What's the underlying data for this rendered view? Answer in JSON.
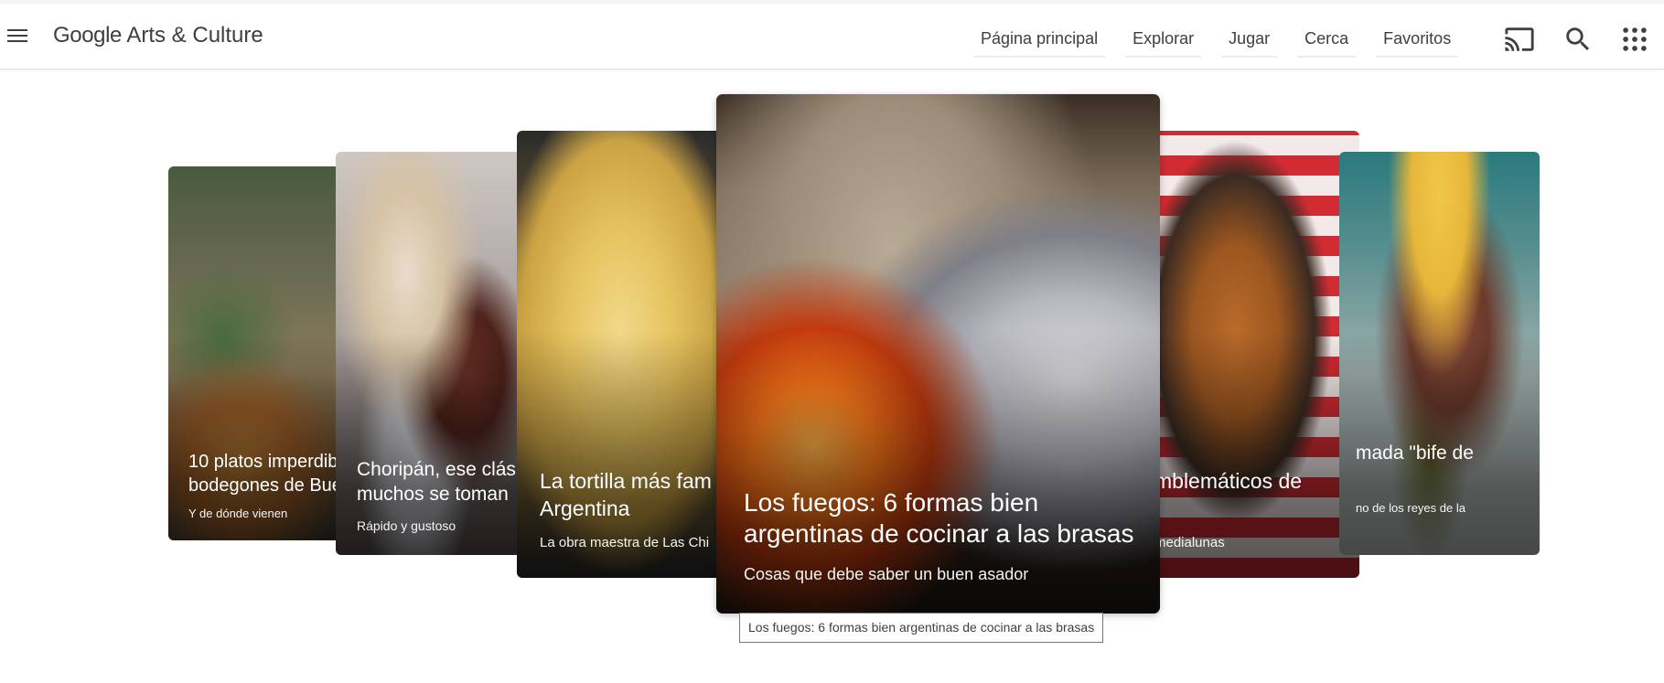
{
  "app": {
    "brand_google": "Google",
    "brand_rest": " Arts & Culture"
  },
  "nav": {
    "items": [
      {
        "label": "Página principal"
      },
      {
        "label": "Explorar"
      },
      {
        "label": "Jugar"
      },
      {
        "label": "Cerca"
      },
      {
        "label": "Favoritos"
      }
    ],
    "icons": [
      "cast-icon",
      "search-icon",
      "apps-icon"
    ]
  },
  "carousel": {
    "cards": [
      {
        "title_1": "10 platos imperdib",
        "title_2": "bodegones de Bue",
        "subtitle": "Y de dónde vienen"
      },
      {
        "title_1": "Choripán, ese clás",
        "title_2": "muchos se toman",
        "subtitle": "Rápido y gustoso"
      },
      {
        "title_1": "La tortilla más fam",
        "title_2": "Argentina",
        "subtitle": "La obra maestra de Las Chi"
      },
      {
        "title_1": "Los fuegos: 6 formas bien",
        "title_2": "argentinas de cocinar a las brasas",
        "subtitle": "Cosas que debe saber un buen asador"
      },
      {
        "title_1": "mblemáticos de",
        "title_2": "",
        "subtitle": "medialunas"
      },
      {
        "title_1": "mada \"bife de",
        "title_2": "",
        "subtitle": "no de los reyes de la"
      }
    ]
  },
  "tooltip": {
    "text": "Los fuegos: 6 formas bien argentinas de cocinar a las brasas"
  },
  "colors": {
    "text": "#3c4043",
    "nav_underline": "#e8eef6"
  }
}
